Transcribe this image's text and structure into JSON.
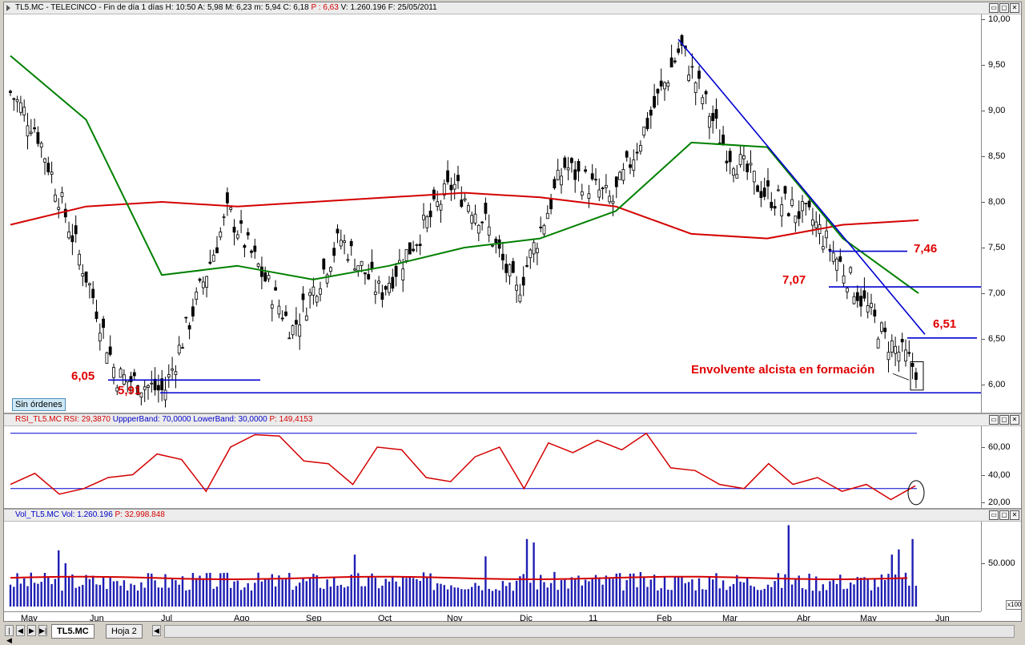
{
  "price_panel": {
    "header": {
      "symbol": "TL5.MC - TELECINCO - Fin de día 1 días",
      "h": "H: 10:50",
      "a": "A: 5,98",
      "m": "M: 6,23",
      "min": "m: 5,94",
      "c": "C: 6,18",
      "p": "P : 6,63",
      "v": "V: 1.260.196",
      "f": "F: 25/05/2011"
    },
    "annotations": {
      "l605": "6,05",
      "l591": "5,91",
      "l707": "7,07",
      "l746": "7,46",
      "l651": "6,51",
      "engulfing": "Envolvente alcista en formación"
    },
    "orders_button": "Sin órdenes"
  },
  "rsi_panel": {
    "header": {
      "name": "RSI_TL5.MC",
      "rsi": "RSI: 29,3870",
      "upper": "UppperBand: 70,0000",
      "lower": "LowerBand: 30,0000",
      "p": "P: 149,4153"
    }
  },
  "vol_panel": {
    "header": {
      "name": "Vol_TL5.MC",
      "vol": "Vol: 1.260.196",
      "p": "P: 32.998.848"
    },
    "scale_badge": "x100"
  },
  "controls": {
    "min": "▭",
    "max": "▢",
    "close": "✕"
  },
  "tabs": {
    "symbol": "TL5.MC",
    "sheet": "Hoja 2"
  },
  "nav": {
    "first": "|◀",
    "prev": "◀",
    "next": "▶",
    "last": "▶|",
    "scroll_left": "◀"
  },
  "colors": {
    "price": "#000000",
    "ma_long": "#d40000",
    "ma_short": "#008000",
    "trend": "#0000d0",
    "rsi": "#d40000",
    "volume": "#1f1fb4",
    "vol_avg": "#d40000"
  },
  "chart_data": [
    {
      "type": "candlestick",
      "title": "TL5.MC - TELECINCO",
      "x_ticks": [
        "May",
        "Jun",
        "Jul",
        "Ago",
        "Sep",
        "Oct",
        "Nov",
        "Dic",
        "11",
        "Feb",
        "Mar",
        "Abr",
        "May",
        "Jun"
      ],
      "y_ticks": [
        "6,00",
        "6,50",
        "7,00",
        "7,50",
        "8,00",
        "8,50",
        "9,00",
        "9,50",
        "10,00"
      ],
      "ylim": [
        5.8,
        10.0
      ],
      "close_samples": [
        {
          "x": "May",
          "y": 9.2
        },
        {
          "x": "Jun",
          "y": 7.0
        },
        {
          "x": "Jun",
          "y": 6.05
        },
        {
          "x": "Jul",
          "y": 5.91
        },
        {
          "x": "Ago",
          "y": 7.9
        },
        {
          "x": "Sep",
          "y": 6.6
        },
        {
          "x": "Oct",
          "y": 7.0
        },
        {
          "x": "Nov",
          "y": 8.2
        },
        {
          "x": "Dic",
          "y": 7.0
        },
        {
          "x": "Dic",
          "y": 8.4
        },
        {
          "x": "11",
          "y": 8.0
        },
        {
          "x": "Feb",
          "y": 9.7
        },
        {
          "x": "Mar",
          "y": 8.6
        },
        {
          "x": "Abr",
          "y": 7.8
        },
        {
          "x": "May",
          "y": 6.5
        },
        {
          "x": "May",
          "y": 6.18
        }
      ],
      "horizontal_levels": [
        5.91,
        6.05,
        6.51,
        7.07,
        7.46
      ],
      "trendline": {
        "from": {
          "x": "Feb",
          "y": 9.78
        },
        "to": {
          "x": "May",
          "y": 6.55
        }
      },
      "series": [
        {
          "name": "MA_long",
          "values": [
            7.75,
            7.95,
            8.0,
            7.95,
            8.0,
            8.05,
            8.1,
            8.05,
            7.95,
            7.65,
            7.6,
            7.75,
            7.8
          ]
        },
        {
          "name": "MA_short",
          "values": [
            9.6,
            8.9,
            7.2,
            7.3,
            7.15,
            7.3,
            7.5,
            7.6,
            7.9,
            8.65,
            8.6,
            7.6,
            7.0
          ]
        }
      ]
    },
    {
      "type": "line",
      "title": "RSI_TL5.MC",
      "y_ticks": [
        "20,00",
        "40,00",
        "60,00"
      ],
      "ylim": [
        15,
        75
      ],
      "upper_band": 70,
      "lower_band": 30,
      "values": [
        33,
        38,
        28,
        30,
        35,
        42,
        55,
        48,
        30,
        60,
        66,
        70,
        50,
        45,
        35,
        60,
        55,
        40,
        35,
        50,
        62,
        30,
        60,
        58,
        65,
        55,
        72,
        45,
        40,
        35,
        30,
        45,
        35,
        38,
        25,
        35,
        22,
        29
      ]
    },
    {
      "type": "bar",
      "title": "Vol_TL5.MC",
      "y_ticks": [
        "50.000"
      ],
      "ylim": [
        0,
        90000
      ],
      "average": 33000,
      "values": [
        33000,
        34000,
        28000,
        30000,
        29000,
        31000,
        33000,
        60000,
        52000,
        65000,
        30000,
        33000,
        29000,
        88000,
        55000,
        35000,
        40000,
        42000,
        62000,
        33000
      ]
    }
  ]
}
